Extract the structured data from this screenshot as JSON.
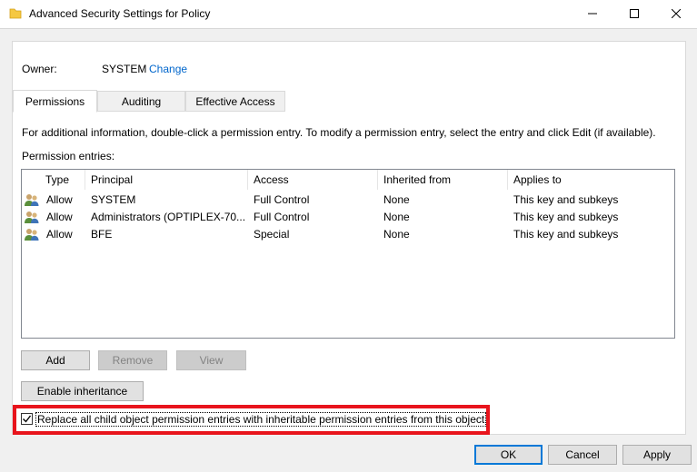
{
  "window": {
    "title": "Advanced Security Settings for Policy"
  },
  "owner": {
    "label": "Owner:",
    "value": "SYSTEM",
    "change_link": "Change"
  },
  "tabs": [
    {
      "label": "Permissions",
      "active": true
    },
    {
      "label": "Auditing",
      "active": false
    },
    {
      "label": "Effective Access",
      "active": false
    }
  ],
  "info_text": "For additional information, double-click a permission entry. To modify a permission entry, select the entry and click Edit (if available).",
  "entries_label": "Permission entries:",
  "table": {
    "headers": [
      "Type",
      "Principal",
      "Access",
      "Inherited from",
      "Applies to"
    ],
    "rows": [
      {
        "type": "Allow",
        "principal": "SYSTEM",
        "access": "Full Control",
        "inherited": "None",
        "applies": "This key and subkeys"
      },
      {
        "type": "Allow",
        "principal": "Administrators (OPTIPLEX-70...",
        "access": "Full Control",
        "inherited": "None",
        "applies": "This key and subkeys"
      },
      {
        "type": "Allow",
        "principal": "BFE",
        "access": "Special",
        "inherited": "None",
        "applies": "This key and subkeys"
      }
    ]
  },
  "buttons": {
    "add": "Add",
    "remove": "Remove",
    "view": "View",
    "enable_inheritance": "Enable inheritance",
    "ok": "OK",
    "cancel": "Cancel",
    "apply": "Apply"
  },
  "replace_checkbox": {
    "label": "Replace all child object permission entries with inheritable permission entries from this object",
    "checked": true
  },
  "colors": {
    "link": "#0066cc",
    "highlight": "#e8141c",
    "focus": "#0078d7"
  }
}
